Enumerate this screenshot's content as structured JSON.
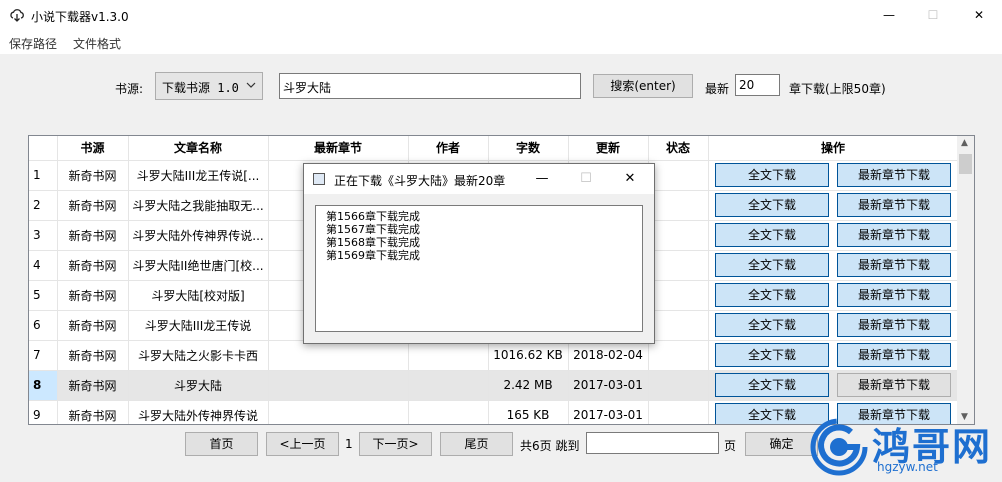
{
  "window": {
    "title": "小说下载器v1.3.0",
    "minimize": "—",
    "maximize": "☐",
    "close": "✕"
  },
  "menu": [
    "保存路径",
    "文件格式"
  ],
  "toolbar": {
    "source_label": "书源:",
    "source_value": "下载书源 1.0",
    "search_value": "斗罗大陆",
    "search_button": "搜索(enter)",
    "latest_label": "最新",
    "latest_value": "20",
    "chapters_label": "章下载(上限50章)"
  },
  "table": {
    "headers": [
      "书源",
      "文章名称",
      "最新章节",
      "作者",
      "字数",
      "更新",
      "状态",
      "操作"
    ],
    "full_download": "全文下载",
    "latest_download": "最新章节下载",
    "rows": [
      {
        "num": "1",
        "source": "新奇书网",
        "name": "斗罗大陆III龙王传说[...",
        "chapter": "",
        "author": "",
        "size": "",
        "updated": "",
        "status": ""
      },
      {
        "num": "2",
        "source": "新奇书网",
        "name": "斗罗大陆之我能抽取无...",
        "chapter": "",
        "author": "",
        "size": "",
        "updated": "",
        "status": ""
      },
      {
        "num": "3",
        "source": "新奇书网",
        "name": "斗罗大陆外传神界传说...",
        "chapter": "",
        "author": "",
        "size": "",
        "updated": "",
        "status": ""
      },
      {
        "num": "4",
        "source": "新奇书网",
        "name": "斗罗大陆II绝世唐门[校...",
        "chapter": "",
        "author": "",
        "size": "",
        "updated": "",
        "status": ""
      },
      {
        "num": "5",
        "source": "新奇书网",
        "name": "斗罗大陆[校对版]",
        "chapter": "",
        "author": "",
        "size": "",
        "updated": "",
        "status": ""
      },
      {
        "num": "6",
        "source": "新奇书网",
        "name": "斗罗大陆III龙王传说",
        "chapter": "",
        "author": "",
        "size": "",
        "updated": "",
        "status": ""
      },
      {
        "num": "7",
        "source": "新奇书网",
        "name": "斗罗大陆之火影卡卡西",
        "chapter": "",
        "author": "",
        "size": "1016.62 KB",
        "updated": "2018-02-04",
        "status": ""
      },
      {
        "num": "8",
        "source": "新奇书网",
        "name": "斗罗大陆",
        "chapter": "",
        "author": "",
        "size": "2.42 MB",
        "updated": "2017-03-01",
        "status": ""
      },
      {
        "num": "9",
        "source": "新奇书网",
        "name": "斗罗大陆外传神界传说",
        "chapter": "",
        "author": "",
        "size": "165 KB",
        "updated": "2017-03-01",
        "status": ""
      }
    ],
    "selected_row": "8"
  },
  "pager": {
    "first": "首页",
    "prev": "<上一页",
    "current": "1",
    "next": "下一页>",
    "last": "尾页",
    "total_jump": "共6页 跳到",
    "jump_value": "",
    "page_suffix": "页",
    "confirm": "确定"
  },
  "dialog": {
    "title": "正在下载《斗罗大陆》最新20章",
    "minimize": "—",
    "maximize": "☐",
    "close": "✕",
    "log": [
      "第1566章下载完成",
      "第1567章下载完成",
      "第1568章下载完成",
      "第1569章下载完成"
    ]
  },
  "watermark": {
    "name": "鸿哥网",
    "url": "hgzyw.net"
  },
  "colors": {
    "accent": "#1e6fd0",
    "button_hover": "#cce4f7",
    "selected_row": "#cce8ff"
  }
}
